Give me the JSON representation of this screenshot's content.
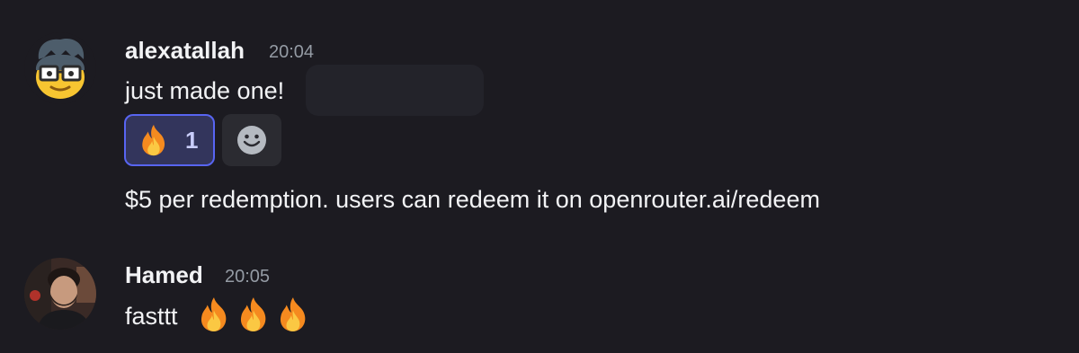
{
  "messages": [
    {
      "username": "alexatallah",
      "timestamp": "20:04",
      "avatar_icon": "nerd-face-avatar",
      "lines": [
        "just made one!",
        "$5 per redemption. users can redeem it on openrouter.ai/redeem"
      ],
      "reactions": [
        {
          "emoji": "fire",
          "count": "1",
          "active": true
        }
      ]
    },
    {
      "username": "Hamed",
      "timestamp": "20:05",
      "avatar_icon": "user-photo-avatar",
      "lines": [
        "fasttt"
      ],
      "emojis": [
        "fire",
        "fire",
        "fire"
      ]
    }
  ],
  "colors": {
    "background": "#1c1b21",
    "accent": "#5865f2",
    "reaction_active_bg": "#33355c",
    "timestamp": "#949ba4"
  }
}
